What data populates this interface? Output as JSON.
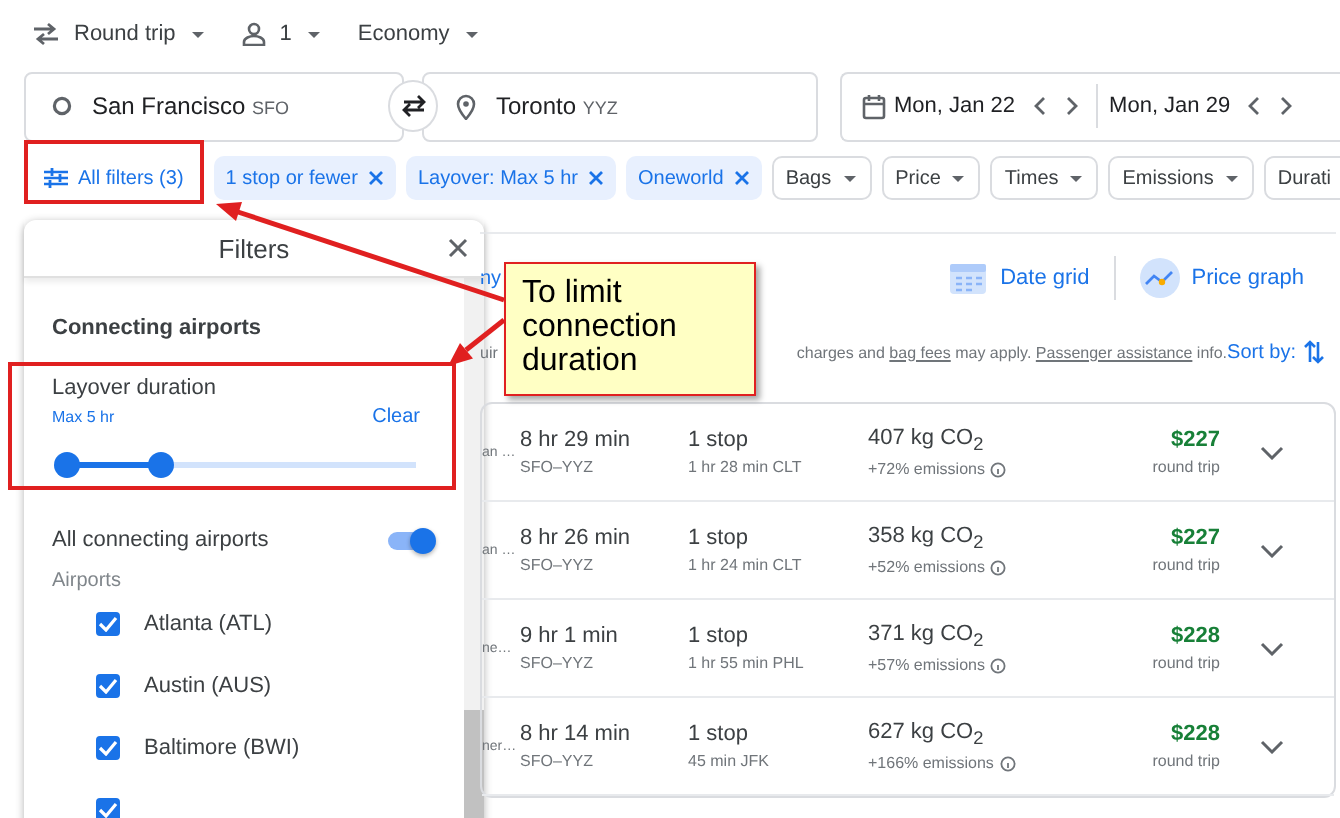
{
  "trip_options": [
    {
      "kind": "trip",
      "label": "Round trip"
    },
    {
      "kind": "passengers",
      "label": "1"
    },
    {
      "kind": "class",
      "label": "Economy"
    }
  ],
  "origin": {
    "city": "San Francisco",
    "code": "SFO"
  },
  "destination": {
    "city": "Toronto",
    "code": "YYZ"
  },
  "dates": [
    "Mon, Jan 22",
    "Mon, Jan 29"
  ],
  "filter_chips": [
    {
      "kind": "all",
      "label": "All filters (3)"
    },
    {
      "kind": "applied",
      "label": "1 stop or fewer"
    },
    {
      "kind": "applied",
      "label": "Layover: Max 5 hr"
    },
    {
      "kind": "applied",
      "label": "Oneworld"
    },
    {
      "kind": "dropdown",
      "label": "Bags"
    },
    {
      "kind": "dropdown",
      "label": "Price"
    },
    {
      "kind": "dropdown",
      "label": "Times"
    },
    {
      "kind": "dropdown",
      "label": "Emissions"
    },
    {
      "kind": "dropdown",
      "label": "Durati"
    }
  ],
  "filters_panel": {
    "title": "Filters",
    "section": "Connecting airports",
    "layover": {
      "label": "Layover duration",
      "value": "Max 5 hr",
      "clear": "Clear",
      "level": 0.27
    },
    "all_airports": {
      "label": "All connecting airports",
      "on": true
    },
    "airports_heading": "Airports",
    "airports": [
      {
        "name": "Atlanta (ATL)",
        "checked": true
      },
      {
        "name": "Austin (AUS)",
        "checked": true
      },
      {
        "name": "Baltimore (BWI)",
        "checked": true
      },
      {
        "checked": true
      }
    ]
  },
  "results": {
    "link_cut": "ny",
    "views": [
      {
        "kind": "date_grid",
        "label": "Date grid"
      },
      {
        "kind": "price_graph",
        "label": "Price graph"
      }
    ],
    "note_cut": "uir",
    "note": [
      {
        "kind": "text",
        "text": "charges and "
      },
      {
        "kind": "link",
        "text": "bag fees"
      },
      {
        "kind": "text",
        "text": " may apply. "
      },
      {
        "kind": "link",
        "text": "Passenger assistance"
      },
      {
        "kind": "text",
        "text": " info."
      }
    ],
    "sort_label": "Sort by:",
    "flights": [
      {
        "airline_cut": "an …",
        "duration": "8 hr 29 min",
        "route": "SFO–YYZ",
        "stops": "1 stop",
        "layover": "1 hr 28 min CLT",
        "emissions": "407 kg CO$_{2}$",
        "emissions_change": "+72% emissions",
        "price": "$227",
        "price_note": "round trip"
      },
      {
        "airline_cut": "an …",
        "duration": "8 hr 26 min",
        "route": "SFO–YYZ",
        "stops": "1 stop",
        "layover": "1 hr 24 min CLT",
        "emissions": "358 kg CO$_{2}$",
        "emissions_change": "+52% emissions",
        "price": "$227",
        "price_note": "round trip"
      },
      {
        "airline_cut": "ne…",
        "duration": "9 hr 1 min",
        "route": "SFO–YYZ",
        "stops": "1 stop",
        "layover": "1 hr 55 min PHL",
        "emissions": "371 kg CO$_{2}$",
        "emissions_change": "+57% emissions",
        "price": "$228",
        "price_note": "round trip"
      },
      {
        "airline_cut": "ner…",
        "duration": "8 hr 14 min",
        "route": "SFO–YYZ",
        "stops": "1 stop",
        "layover": "45 min JFK",
        "emissions": "627 kg CO$_{2}$",
        "emissions_change": "+166% emissions",
        "price": "$228",
        "price_note": "round trip"
      }
    ]
  },
  "callout": {
    "text": "To limit connection duration"
  }
}
